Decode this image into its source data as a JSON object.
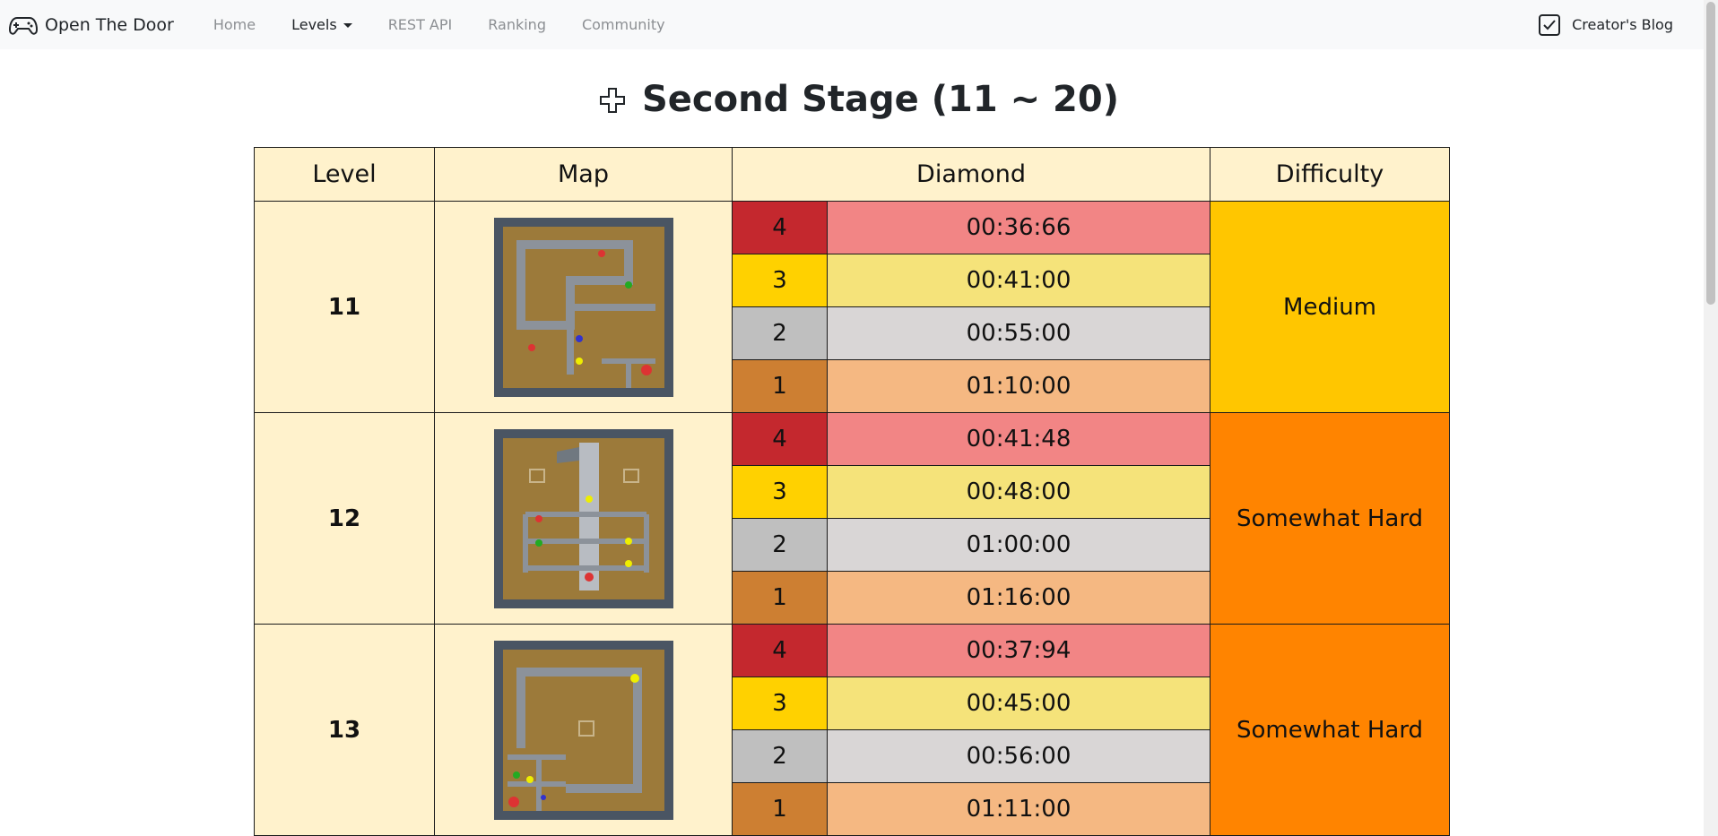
{
  "navbar": {
    "brand": "Open The Door",
    "links": [
      "Home",
      "Levels",
      "REST API",
      "Ranking",
      "Community"
    ],
    "blog": "Creator's Blog"
  },
  "title": "Second Stage (11 ~ 20)",
  "table": {
    "headers": [
      "Level",
      "Map",
      "Diamond",
      "Difficulty"
    ],
    "rows": [
      {
        "level": "11",
        "difficulty": "Medium",
        "diamonds": [
          {
            "rank": "4",
            "time": "00:36:66"
          },
          {
            "rank": "3",
            "time": "00:41:00"
          },
          {
            "rank": "2",
            "time": "00:55:00"
          },
          {
            "rank": "1",
            "time": "01:10:00"
          }
        ]
      },
      {
        "level": "12",
        "difficulty": "Somewhat Hard",
        "diamonds": [
          {
            "rank": "4",
            "time": "00:41:48"
          },
          {
            "rank": "3",
            "time": "00:48:00"
          },
          {
            "rank": "2",
            "time": "01:00:00"
          },
          {
            "rank": "1",
            "time": "01:16:00"
          }
        ]
      },
      {
        "level": "13",
        "difficulty": "Somewhat Hard",
        "diamonds": [
          {
            "rank": "4",
            "time": "00:37:94"
          },
          {
            "rank": "3",
            "time": "00:45:00"
          },
          {
            "rank": "2",
            "time": "00:56:00"
          },
          {
            "rank": "1",
            "time": "01:11:00"
          }
        ]
      }
    ]
  },
  "colors": {
    "header_bg": "#fff2cc",
    "medium": "#ffc600",
    "somewhat_hard": "#ff8400",
    "rank4": "#c4282e",
    "rank3": "#ffd100",
    "rank2": "#bfbfbf",
    "rank1": "#cd7f32"
  },
  "icons": {
    "brand": "gamepad-icon",
    "blog": "checkbox-icon",
    "title": "dpad-icon"
  }
}
